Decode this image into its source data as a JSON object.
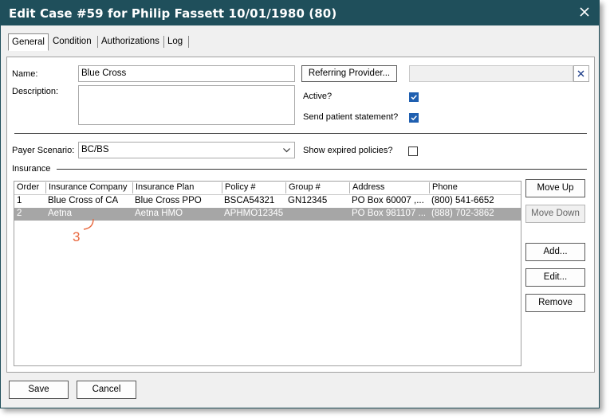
{
  "window": {
    "title": "Edit Case #59 for Philip Fassett  10/01/1980 (80)"
  },
  "tabs": [
    {
      "label": "General",
      "active": true
    },
    {
      "label": "Condition",
      "active": false
    },
    {
      "label": "Authorizations",
      "active": false
    },
    {
      "label": "Log",
      "active": false
    }
  ],
  "form": {
    "name_label": "Name:",
    "name_value": "Blue Cross",
    "description_label": "Description:",
    "description_value": "",
    "referring_provider_button": "Referring Provider...",
    "referring_provider_value": "",
    "active_label": "Active?",
    "active_checked": true,
    "send_statement_label": "Send patient statement?",
    "send_statement_checked": true,
    "payer_scenario_label": "Payer Scenario:",
    "payer_scenario_value": "BC/BS",
    "show_expired_label": "Show expired policies?",
    "show_expired_checked": false,
    "insurance_section_label": "Insurance"
  },
  "insurance_table": {
    "columns": [
      "Order",
      "Insurance Company",
      "Insurance Plan",
      "Policy #",
      "Group #",
      "Address",
      "Phone"
    ],
    "rows": [
      {
        "order": "1",
        "company": "Blue Cross of CA",
        "plan": "Blue Cross PPO",
        "policy": "BSCA54321",
        "group": "GN12345",
        "address": "PO Box 60007 ,...",
        "phone": "(800) 541-6652",
        "selected": false
      },
      {
        "order": "2",
        "company": "Aetna",
        "plan": "Aetna HMO",
        "policy": "APHMO12345",
        "group": "",
        "address": "PO Box 981107 ...",
        "phone": "(888) 702-3862",
        "selected": true
      }
    ]
  },
  "side_buttons": {
    "move_up": "Move Up",
    "move_down": "Move Down",
    "add": "Add...",
    "edit": "Edit...",
    "remove": "Remove"
  },
  "footer": {
    "save": "Save",
    "cancel": "Cancel"
  },
  "annotation": {
    "number": "3",
    "color": "#e9673d"
  },
  "colors": {
    "titlebar": "#1f4f5b",
    "selected_row": "#a6a6a6",
    "checkbox": "#1f5fb0"
  },
  "icons": {
    "close": "close-icon",
    "clear": "clear-x-icon",
    "dropdown": "chevron-down-icon",
    "check": "checkmark-icon"
  }
}
